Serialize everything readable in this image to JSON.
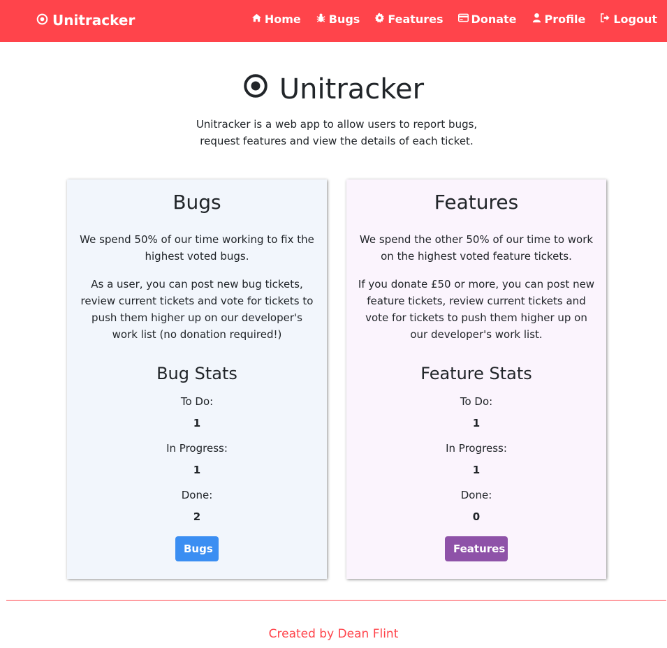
{
  "navbar": {
    "brand": "Unitracker",
    "links": [
      {
        "label": "Home",
        "icon": "home-icon"
      },
      {
        "label": "Bugs",
        "icon": "bug-icon"
      },
      {
        "label": "Features",
        "icon": "cog-icon"
      },
      {
        "label": "Donate",
        "icon": "credit-card-icon"
      },
      {
        "label": "Profile",
        "icon": "user-icon"
      },
      {
        "label": "Logout",
        "icon": "logout-icon"
      }
    ]
  },
  "hero": {
    "title": "Unitracker",
    "description": "Unitracker is a web app to allow users to report bugs, request features and view the details of each ticket."
  },
  "bugs_card": {
    "title": "Bugs",
    "paragraph1": "We spend 50% of our time working to fix the highest voted bugs.",
    "paragraph2": "As a user, you can post new bug tickets, review current tickets and vote for tickets to push them higher up on our developer's work list (no donation required!)",
    "stats_title": "Bug Stats",
    "todo_label": "To Do:",
    "todo_value": "1",
    "inprogress_label": "In Progress:",
    "inprogress_value": "1",
    "done_label": "Done:",
    "done_value": "2",
    "button_label": "Bugs"
  },
  "features_card": {
    "title": "Features",
    "paragraph1": "We spend the other 50% of our time to work on the highest voted feature tickets.",
    "paragraph2": "If you donate £50 or more, you can post new feature tickets, review current tickets and vote for tickets to push them higher up on our developer's work list.",
    "stats_title": "Feature Stats",
    "todo_label": "To Do:",
    "todo_value": "1",
    "inprogress_label": "In Progress:",
    "inprogress_value": "1",
    "done_label": "Done:",
    "done_value": "0",
    "button_label": "Features"
  },
  "footer": {
    "text": "Created by Dean Flint"
  },
  "colors": {
    "brand": "#ff444b",
    "bugs_card_bg": "#f2f6fc",
    "features_card_bg": "#fbf4fd",
    "bugs_button": "#3b8ef2",
    "features_button": "#8e52a8"
  }
}
